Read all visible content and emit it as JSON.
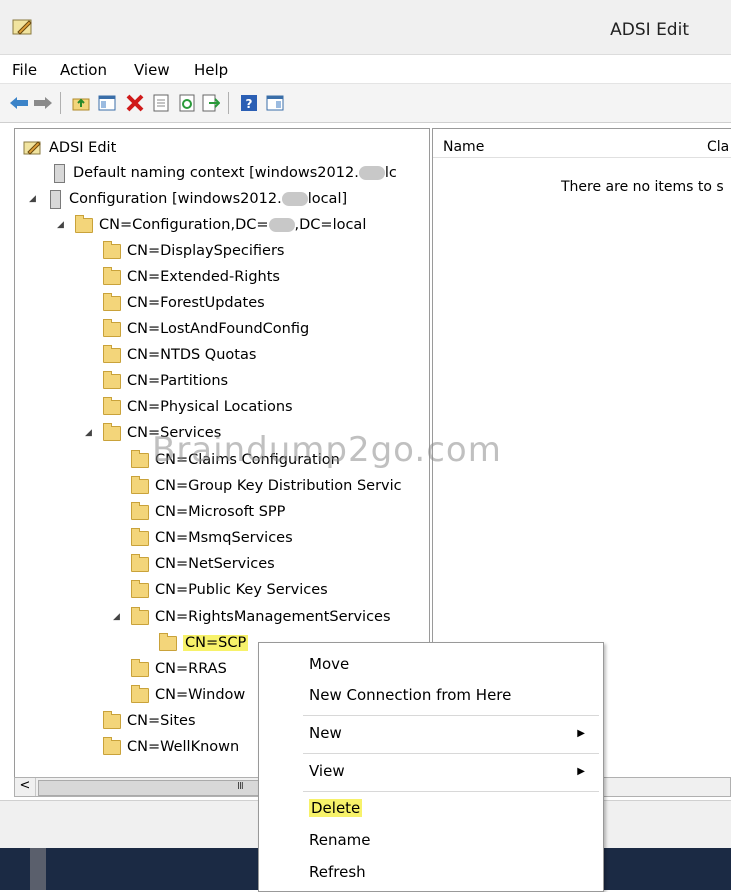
{
  "window": {
    "title": "ADSI Edit"
  },
  "menu": [
    "File",
    "Action",
    "View",
    "Help"
  ],
  "toolbar_icons": [
    "back-icon",
    "forward-icon",
    "up-folder-icon",
    "show-hide-tree-icon",
    "delete-icon",
    "properties-icon",
    "refresh-icon",
    "export-icon",
    "help-icon",
    "console-view-icon"
  ],
  "tree": {
    "root": "ADSI Edit",
    "default_context": "Default naming context [windows2012.",
    "default_context_suffix": "lc",
    "configuration": "Configuration [windows2012.",
    "configuration_suffix": "local]",
    "cn_configuration_prefix": "CN=Configuration,DC=",
    "cn_configuration_suffix": ",DC=local",
    "children": [
      "CN=DisplaySpecifiers",
      "CN=Extended-Rights",
      "CN=ForestUpdates",
      "CN=LostAndFoundConfig",
      "CN=NTDS Quotas",
      "CN=Partitions",
      "CN=Physical Locations"
    ],
    "services": "CN=Services",
    "services_children": [
      "CN=Claims Configuration",
      "CN=Group Key Distribution Servic",
      "CN=Microsoft SPP",
      "CN=MsmqServices",
      "CN=NetServices",
      "CN=Public Key Services"
    ],
    "rms": "CN=RightsManagementServices",
    "scp": "CN=SCP",
    "after": [
      "CN=RRAS",
      "CN=Window"
    ],
    "sites": "CN=Sites",
    "wellknown": "CN=WellKnown"
  },
  "list": {
    "col_name": "Name",
    "col_class": "Cla",
    "empty": "There are no items to s"
  },
  "scroll": {
    "left_arrow": "<",
    "grip": "III"
  },
  "context_menu": {
    "move": "Move",
    "new_connection": "New Connection from Here",
    "new": "New",
    "view": "View",
    "delete": "Delete",
    "rename": "Rename",
    "refresh": "Refresh",
    "submenu_arrow": "▶"
  },
  "watermark": "Braindump2go.com",
  "colors": {
    "highlight": "#f7f26a",
    "folder": "#f3d57a",
    "taskbar": "#1b2a44"
  }
}
